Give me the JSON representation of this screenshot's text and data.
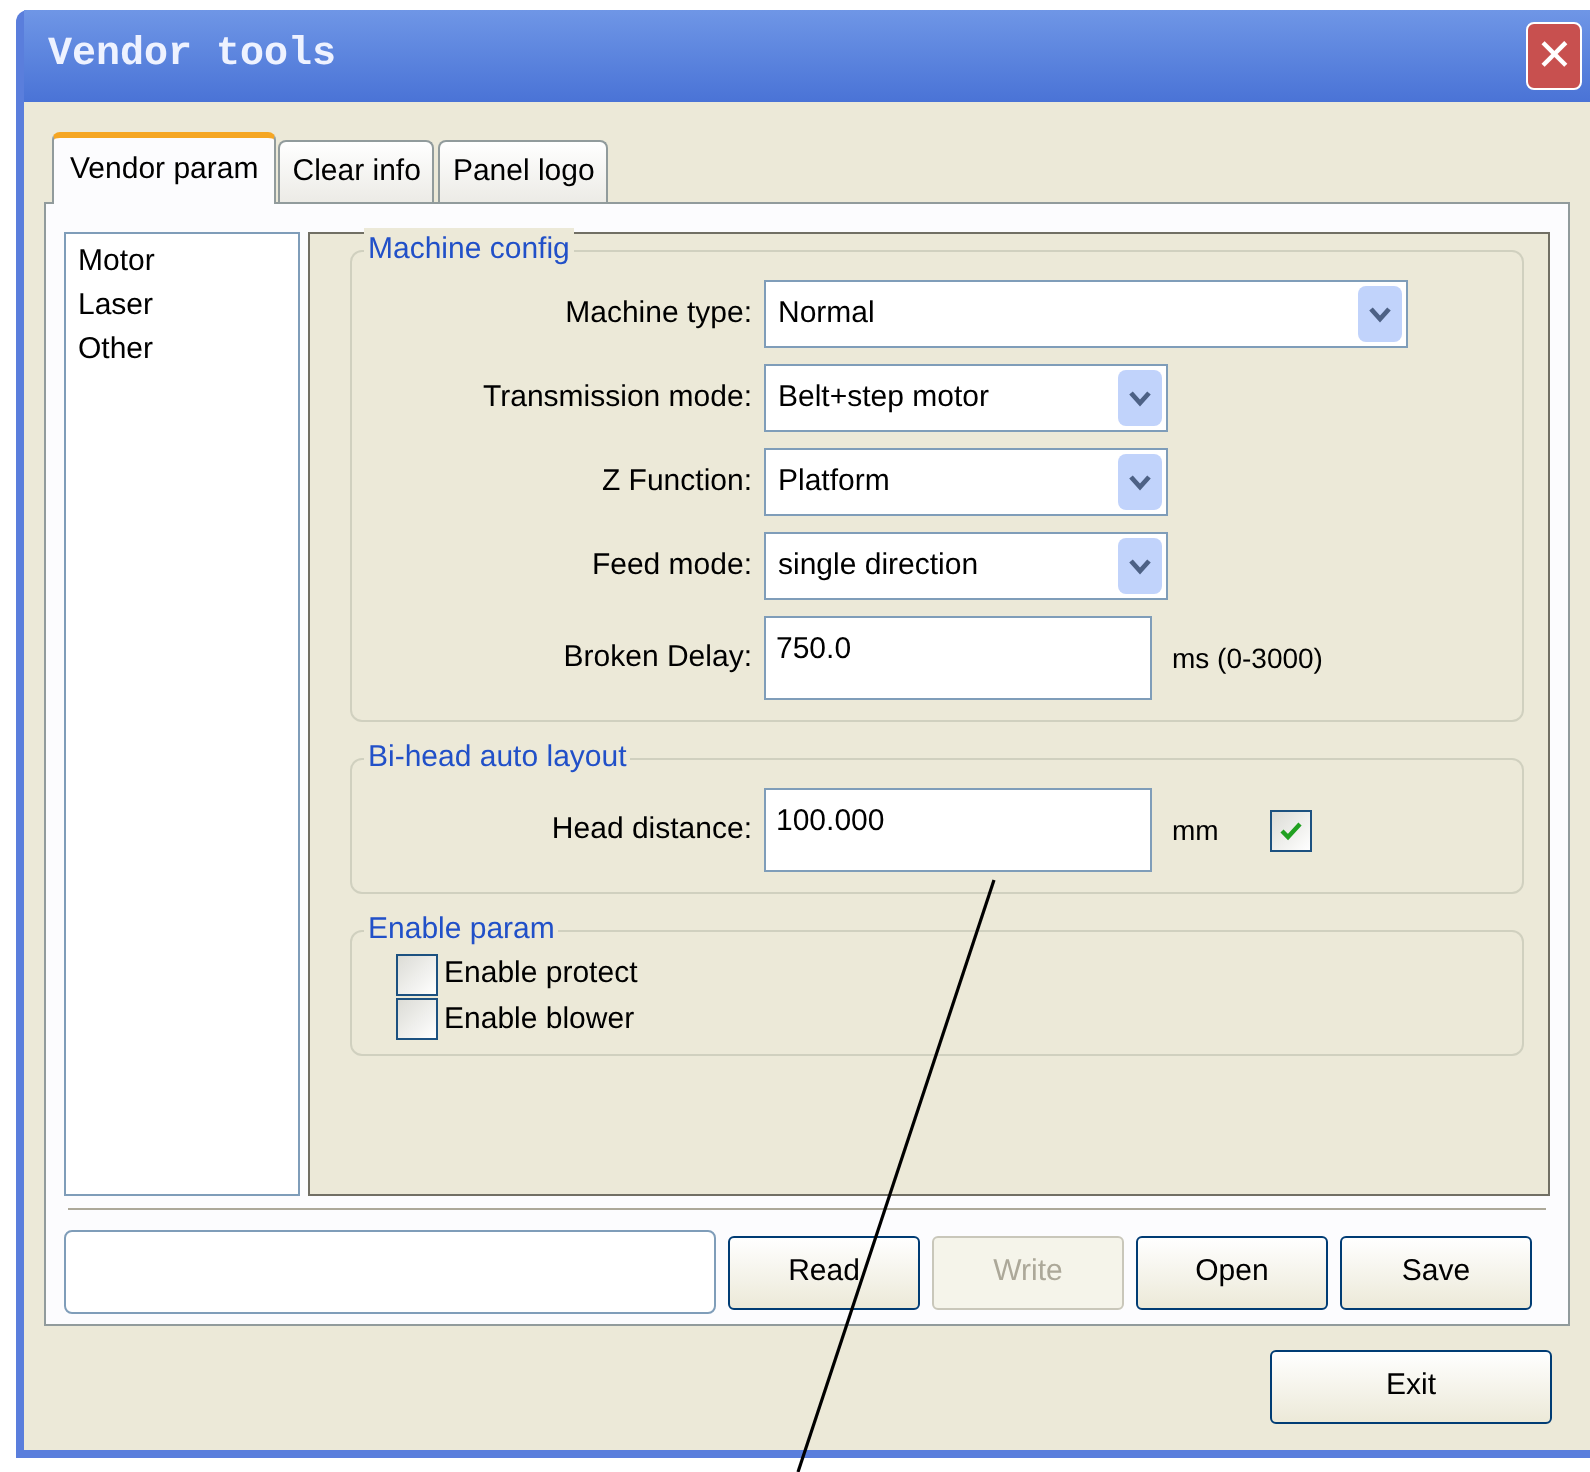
{
  "window": {
    "title": "Vendor tools",
    "close": "✕"
  },
  "tabs": [
    {
      "label": "Vendor param",
      "selected": true
    },
    {
      "label": "Clear info",
      "selected": false
    },
    {
      "label": "Panel logo",
      "selected": false
    }
  ],
  "sidebar": {
    "items": [
      {
        "label": "Motor",
        "selected": false
      },
      {
        "label": "Laser",
        "selected": false
      },
      {
        "label": "Other",
        "selected": false
      }
    ]
  },
  "groups": [
    {
      "title": "Machine config",
      "rows": [
        {
          "kind": "select",
          "label": "Machine type:",
          "value": "Normal",
          "wide": true
        },
        {
          "kind": "select",
          "label": "Transmission mode:",
          "value": "Belt+step motor"
        },
        {
          "kind": "select",
          "label": "Z Function:",
          "value": "Platform"
        },
        {
          "kind": "select",
          "label": "Feed mode:",
          "value": "single direction"
        },
        {
          "kind": "input",
          "label": "Broken Delay:",
          "value": "750.0",
          "unit": "ms (0-3000)"
        }
      ]
    },
    {
      "title": "Bi-head auto layout",
      "rows": [
        {
          "kind": "input",
          "label": "Head distance:",
          "value": "100.000",
          "unit": "mm",
          "checked": true
        }
      ]
    },
    {
      "title": "Enable param",
      "rows": [
        {
          "kind": "checkbox",
          "label": "Enable protect",
          "checked": false
        },
        {
          "kind": "checkbox",
          "label": "Enable blower",
          "checked": false
        }
      ]
    }
  ],
  "buttons": [
    {
      "label": "Read",
      "disabled": false
    },
    {
      "label": "Write",
      "disabled": true
    },
    {
      "label": "Open",
      "disabled": false
    },
    {
      "label": "Save",
      "disabled": false
    }
  ],
  "exit_button": "Exit"
}
